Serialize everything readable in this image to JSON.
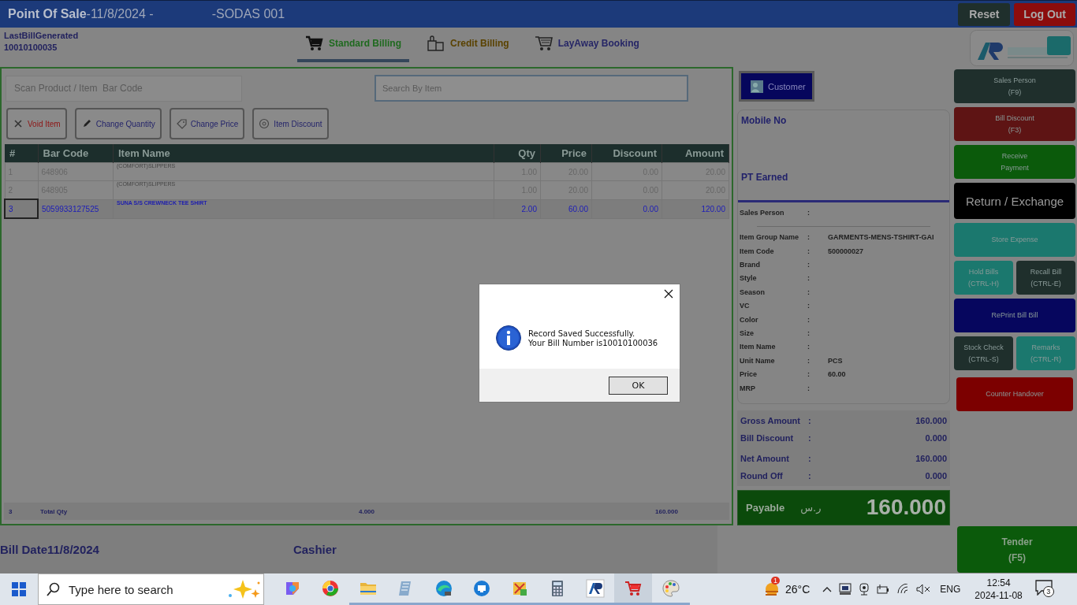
{
  "title_bar": {
    "app_name": "Point Of Sale",
    "date": "-11/8/2024 -",
    "store": "-SODAS 001",
    "buttons": [
      {
        "label": "Reset",
        "color": "#1f2f2c"
      },
      {
        "label": "Log Out",
        "color": "#8c0c0c"
      }
    ]
  },
  "last_bill": {
    "label": "LastBillGenerated",
    "number": "10010100035"
  },
  "billing_tabs": [
    {
      "label": "Standard Billing",
      "kind": "cart",
      "selected": true,
      "color": "#1f6a1f"
    },
    {
      "label": "Credit Billing",
      "kind": "bags",
      "selected": false,
      "color": "#5a4200"
    },
    {
      "label": "LayAway Booking",
      "kind": "trolley",
      "selected": false,
      "color": "#262666"
    }
  ],
  "scan_field": {
    "placeholder": "Scan Product / Item  Bar Code"
  },
  "search_field": {
    "placeholder": "Search By Item"
  },
  "tools": [
    {
      "label": "Void Item",
      "kind": "void",
      "color": "#8e1414"
    },
    {
      "label": "Change Quantity",
      "kind": "pencil",
      "color": "#24246a"
    },
    {
      "label": "Change Price",
      "kind": "tag",
      "color": "#24246a"
    },
    {
      "label": "Item Discount",
      "kind": "discount",
      "color": "#24246a"
    }
  ],
  "table": {
    "columns": [
      "#",
      "Bar Code",
      "Item Name",
      "Qty",
      "Price",
      "Discount",
      "Amount"
    ],
    "rows": [
      {
        "cells": [
          "1",
          "648906",
          "(COMFORT)SLIPPERS",
          "1.00",
          "20.00",
          "0.00",
          "20.00"
        ],
        "selected": false
      },
      {
        "cells": [
          "2",
          "648905",
          "(COMFORT)SLIPPERS",
          "1.00",
          "20.00",
          "0.00",
          "20.00"
        ],
        "selected": false
      },
      {
        "cells": [
          "3",
          "5059933127525",
          "SUNA S/S CREWNECK TEE SHIRT",
          "2.00",
          "60.00",
          "0.00",
          "120.00"
        ],
        "selected": true
      }
    ],
    "footer": {
      "count": "3",
      "label": "Total Qty",
      "qty": "4.000",
      "amount": "160.000"
    }
  },
  "customer_button": {
    "label": "Customer"
  },
  "customer_card": {
    "mobile_label": "Mobile No",
    "points_label": "PT Earned"
  },
  "sales_person": {
    "label": "Sales Person",
    "separator": ":"
  },
  "item_details": [
    {
      "label": "Item Group Name",
      "separator": ":",
      "value": "GARMENTS-MENS-TSHIRT-GAI"
    },
    {
      "label": "Item Code",
      "separator": ":",
      "value": "500000027"
    },
    {
      "label": "Brand",
      "separator": ":"
    },
    {
      "label": "Style",
      "separator": ":"
    },
    {
      "label": "Season",
      "separator": ":"
    },
    {
      "label": "VC",
      "separator": ":"
    },
    {
      "label": "Color",
      "separator": ":"
    },
    {
      "label": "Size",
      "separator": ":"
    },
    {
      "label": "Item Name",
      "separator": ":"
    },
    {
      "label": "Unit Name",
      "separator": ":",
      "value": "PCS"
    },
    {
      "label": "Price",
      "separator": ":",
      "value": "60.00"
    },
    {
      "label": "MRP",
      "separator": ":"
    }
  ],
  "totals": [
    {
      "label": "Gross Amount",
      "separator": ":",
      "value": "160.000"
    },
    {
      "label": "Bill Discount",
      "separator": ":",
      "value": "0.000"
    },
    {
      "label": "Net Amount",
      "separator": ":",
      "value": "160.000"
    },
    {
      "label": "Round Off",
      "separator": ":",
      "value": "0.000"
    }
  ],
  "payable": {
    "label": "Payable",
    "currency": "ر.س",
    "amount": "160.000"
  },
  "action_rows": [
    [
      {
        "lines": [
          "Sales Person",
          "(F9)"
        ],
        "kind": "normal",
        "color": "#1f2f2c"
      }
    ],
    [
      {
        "lines": [
          "Bill Discount",
          "(F3)"
        ],
        "kind": "normal",
        "color": "#5e1414"
      }
    ],
    [
      {
        "lines": [
          "Receive",
          "Payment"
        ],
        "kind": "normal",
        "color": "#0b5a0b"
      }
    ],
    [
      {
        "lines": [
          "Return / Exchange"
        ],
        "kind": "large",
        "color": "#000000"
      }
    ],
    [
      {
        "lines": [
          "Store Expense"
        ],
        "kind": "normal",
        "color": "#1b786e"
      }
    ],
    [
      {
        "lines": [
          "Hold Bills",
          "(CTRL-H)"
        ],
        "kind": "normal",
        "color": "#1b786e"
      },
      {
        "lines": [
          "Recall Bill",
          "(CTRL-E)"
        ],
        "kind": "normal",
        "color": "#1f2f2c"
      }
    ],
    [
      {
        "lines": [
          "RePrint Bill Bill"
        ],
        "kind": "normal",
        "color": "#06065e"
      }
    ],
    [
      {
        "lines": [
          "Stock Check",
          "(CTRL-S)"
        ],
        "kind": "normal",
        "color": "#1f2f2c"
      },
      {
        "lines": [
          "Remarks",
          "(CTRL-R)"
        ],
        "kind": "normal",
        "color": "#1b786e"
      }
    ],
    [
      {
        "lines": [
          "Counter Handover"
        ],
        "kind": "normal",
        "color": "#7c0000"
      }
    ]
  ],
  "bottom": {
    "bill_date": "Bill Date11/8/2024",
    "cashier": "Cashier"
  },
  "tender_button": {
    "lines": [
      "Tender",
      "(F5)"
    ]
  },
  "dialog": {
    "lines": [
      "Record Saved Successfully.",
      "Your Bill Number is10010100036"
    ],
    "ok": "OK"
  },
  "taskbar": {
    "search_text": "Type here to search",
    "apps": [
      {
        "kind": "sparkle",
        "running": false,
        "selected": false
      },
      {
        "kind": "globe",
        "running": false,
        "selected": false
      },
      {
        "kind": "folder",
        "running": true,
        "selected": false
      },
      {
        "kind": "notepad",
        "running": true,
        "selected": false
      },
      {
        "kind": "wave",
        "running": true,
        "selected": false
      },
      {
        "kind": "monitor",
        "running": true,
        "selected": false
      },
      {
        "kind": "tools",
        "running": true,
        "selected": false
      },
      {
        "kind": "calculator",
        "running": true,
        "selected": false
      },
      {
        "kind": "logo",
        "running": true,
        "selected": false
      },
      {
        "kind": "cart",
        "running": true,
        "selected": true
      },
      {
        "kind": "palette",
        "running": true,
        "selected": false
      }
    ],
    "weather_badge": "1",
    "temperature": "26°C",
    "language": "ENG",
    "time": "12:54",
    "date": "2024-11-08",
    "notifications": "3"
  }
}
